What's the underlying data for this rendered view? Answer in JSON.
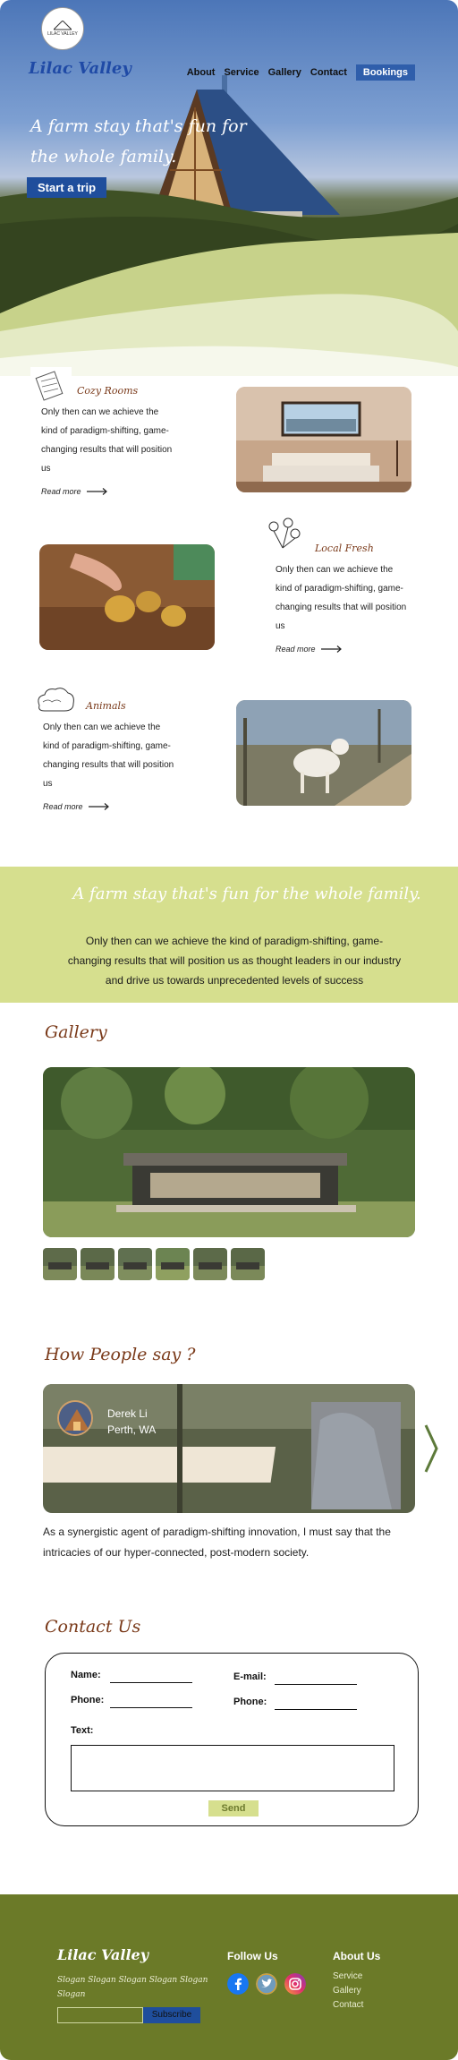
{
  "header": {
    "logo_text": "LILAC VALLEY",
    "brand": "Lilac Valley",
    "nav": [
      "About",
      "Service",
      "Gallery",
      "Contact",
      "Bookings"
    ]
  },
  "hero": {
    "title": "A farm stay that's fun for the whole family.",
    "cta": "Start a trip"
  },
  "features": [
    {
      "title": "Cozy Rooms",
      "text": "Only then can we achieve the kind of paradigm-shifting, game-changing results that will position us",
      "link": "Read more",
      "icon": "bed-sketch-icon"
    },
    {
      "title": "Local Fresh",
      "text": "Only then can we achieve the kind of paradigm-shifting, game-changing results that will position us",
      "link": "Read more",
      "icon": "flower-sketch-icon"
    },
    {
      "title": "Animals",
      "text": "Only then can we achieve the kind of paradigm-shifting, game-changing results that will position us",
      "link": "Read more",
      "icon": "sheep-sketch-icon"
    }
  ],
  "banner": {
    "title": "A farm stay that's fun for the whole family.",
    "text": "Only then can we achieve the kind of paradigm-shifting, game-changing results that will position us as thought leaders in our industry and drive us towards unprecedented levels of success"
  },
  "gallery": {
    "heading": "Gallery"
  },
  "testimonials": {
    "heading": "How People say ?",
    "name": "Derek Li",
    "place": "Perth, WA",
    "quote": "As a synergistic agent of paradigm-shifting innovation, I must say that the intricacies of our hyper-connected, post-modern society."
  },
  "contact": {
    "heading": "Contact Us",
    "name_label": "Name:",
    "email_label": "E-mail:",
    "phone_label": "Phone:",
    "phone2_label": "Phone:",
    "text_label": "Text:",
    "send": "Send"
  },
  "footer": {
    "brand": "Lilac Valley",
    "slogan": "Slogan Slogan Slogan Slogan Slogan Slogan",
    "subscribe": "Subscribe",
    "follow": "Follow Us",
    "about": "About Us",
    "links": [
      "Service",
      "Gallery",
      "Contact"
    ]
  },
  "colors": {
    "brand_blue": "#2f5eab",
    "olive": "#6b7a28",
    "lime": "#d6df8e",
    "heading_brown": "#7a3a1a"
  }
}
